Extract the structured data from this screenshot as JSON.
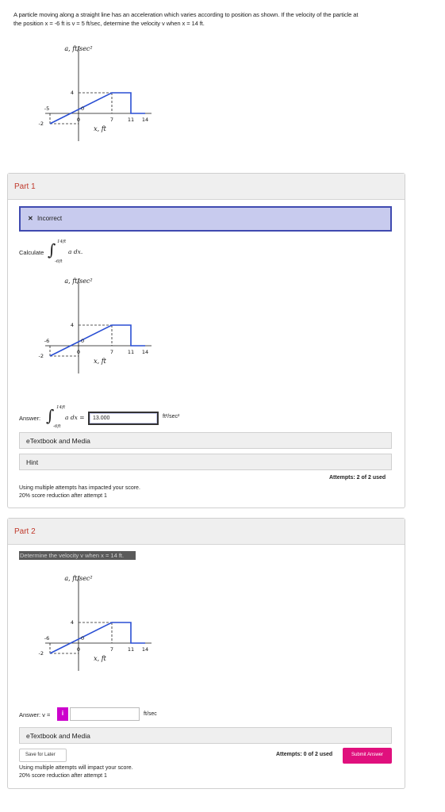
{
  "problem": {
    "line1": "A particle moving along a straight line has an acceleration which varies according to position as shown. If the velocity of the particle at",
    "line2": "the position x = -6 ft is v = 5 ft/sec, determine the velocity v when x = 14 ft."
  },
  "graph": {
    "y_title": "a, ft/sec²",
    "x_title": "x, ft",
    "y_labels": {
      "top": "4",
      "bottom": "-2"
    },
    "x_labels": {
      "left": "-6",
      "left_top": "-5",
      "zero_axis": "0",
      "zero": "0",
      "seven": "7",
      "eleven": "11",
      "fourteen": "14"
    },
    "points": [
      [
        -6,
        -2
      ],
      [
        7,
        4
      ],
      [
        11,
        4
      ],
      [
        11,
        0
      ],
      [
        14,
        0
      ]
    ]
  },
  "part1": {
    "title": "Part 1",
    "status_icon": "x-icon",
    "status_text": "Incorrect",
    "calculate_label": "Calculate",
    "integral_upper": "14ft",
    "integral_lower": "-6ft",
    "integrand": "a dx.",
    "answer_label": "Answer:",
    "answer_integrand": "a dx =",
    "answer_value": "13.000",
    "answer_unit": "ft²/sec²",
    "etextbook": "eTextbook and Media",
    "hint": "Hint",
    "note1": "Using multiple attempts has impacted your score.",
    "note2": "20% score reduction after attempt 1",
    "attempts": "Attempts: 2 of 2 used"
  },
  "part2": {
    "title": "Part 2",
    "prompt": "Determine the velocity v when x = 14 ft.",
    "answer_label": "Answer: v =",
    "info_glyph": "i",
    "answer_value": "",
    "answer_unit": "ft/sec",
    "etextbook": "eTextbook and Media",
    "save": "Save for Later",
    "attempts": "Attempts: 0 of 2 used",
    "submit": "Submit Answer",
    "note1": "Using multiple attempts will impact your score.",
    "note2": "20% score reduction after attempt 1"
  },
  "colors": {
    "line": "#2a4fd4",
    "incorrect_bg": "#c8cbee",
    "incorrect_border": "#3f4ab0",
    "part_title": "#c0392b",
    "submit": "#e0107d",
    "info": "#cc00cc"
  }
}
